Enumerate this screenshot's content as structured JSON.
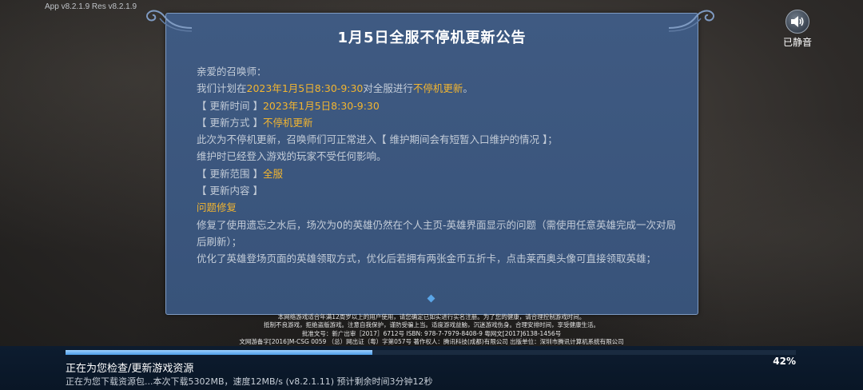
{
  "version_text": "App v8.2.1.9   Res v8.2.1.9",
  "mute": {
    "icon": "speaker-icon",
    "label": "已静音"
  },
  "announcement": {
    "title": "1月5日全服不停机更新公告",
    "greeting": "亲爱的召唤师：",
    "line1_pre": "我们计划在",
    "line1_time": "2023年1月5日8:30-9:30",
    "line1_mid": "对全服进行",
    "line1_highlight": "不停机更新",
    "line1_end": "。",
    "time_label": "【 更新时间 】",
    "time_value": "2023年1月5日8:30-9:30",
    "method_label": "【 更新方式 】",
    "method_value": "不停机更新",
    "desc1": "此次为不停机更新，召唤师们可正常进入【 维护期间会有短暂入口维护的情况 】；",
    "desc2": "维护时已经登入游戏的玩家不受任何影响。",
    "scope_label": "【 更新范围 】",
    "scope_value": "全服",
    "content_label": "【 更新内容 】",
    "fix_heading": "问题修复",
    "fix1": "修复了使用遗忘之水后，场次为0的英雄仍然在个人主页-英雄界面显示的问题（需使用任意英雄完成一次对局后刷新）；",
    "fix2": "优化了英雄登场页面的英雄领取方式，优化后若拥有两张金币五折卡，点击莱西奥头像可直接领取英雄；"
  },
  "legal": {
    "line1": "本网络游戏适合年满12周岁以上的用户使用，请您确定已如实进行实名注册。为了您的健康，请合理控制游戏时间。",
    "line2": "抵制不良游戏，拒绝盗版游戏。注意自我保护，谨防受骗上当。适度游戏益脑，沉迷游戏伤身。合理安排时间，享受健康生活。",
    "line3": "批准文号：新广出审［2017］6712号  ISBN: 978-7-7979-8408-9  粤网文[2017]6138-1456号",
    "line4": "文网游备字[2016]M-CSG 0059 （总）网出证（粤）字第057号  著作权人：腾讯科技(成都)有限公司  出版单位：深圳市腾讯计算机系统有限公司"
  },
  "download": {
    "progress_fraction": 0.42,
    "progress_text": "42%",
    "status_main": "正在为您检查/更新游戏资源",
    "status_sub": "正在为您下载资源包...本次下载5302MB，速度12MB/s (v8.2.1.11)  预计剩余时间3分钟12秒"
  },
  "colors": {
    "highlight": "#f2b530",
    "panel": "#3f5a82",
    "progress": "#4d9ee8"
  }
}
